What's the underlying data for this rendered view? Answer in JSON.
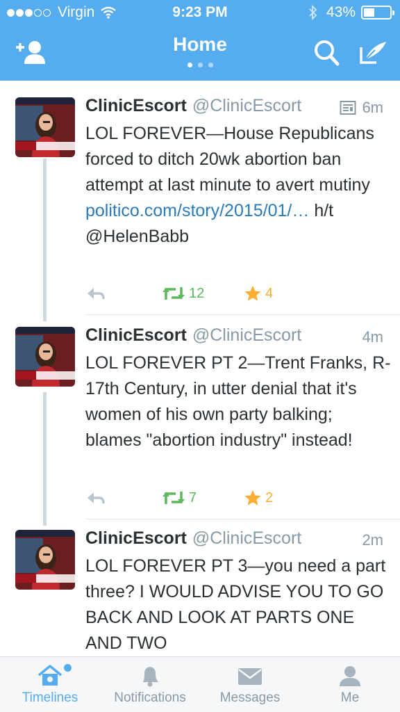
{
  "status_bar": {
    "carrier": "Virgin",
    "time": "9:23 PM",
    "battery": "43%",
    "battery_level": 0.43
  },
  "nav": {
    "title": "Home",
    "page_count": 3,
    "active_page": 1
  },
  "colors": {
    "brand": "#55acee",
    "link": "#2b7bb9",
    "retweet": "#5cb85c",
    "favorite": "#ffac33"
  },
  "tweets": [
    {
      "name": "ClinicEscort",
      "handle": "@ClinicEscort",
      "time": "6m",
      "text": "LOL FOREVER—House Republicans forced to ditch 20wk abortion ban attempt at last minute to avert mutiny",
      "link": "politico.com/story/2015/01/…",
      "text_after": " h/t @HelenBabb",
      "retweets": "12",
      "favorites": "4",
      "has_summary_icon": true
    },
    {
      "name": "ClinicEscort",
      "handle": "@ClinicEscort",
      "time": "4m",
      "text": "LOL FOREVER PT 2—Trent Franks, R-17th Century, in utter denial that it's women of his own party balking; blames \"abortion industry\" instead!",
      "retweets": "7",
      "favorites": "2"
    },
    {
      "name": "ClinicEscort",
      "handle": "@ClinicEscort",
      "time": "2m",
      "text": "LOL FOREVER PT 3—you need a part three? I WOULD ADVISE YOU TO GO BACK AND LOOK AT PARTS ONE AND TWO"
    }
  ],
  "tabs": [
    {
      "label": "Timelines",
      "icon": "home-icon",
      "active": true
    },
    {
      "label": "Notifications",
      "icon": "bell-icon"
    },
    {
      "label": "Messages",
      "icon": "envelope-icon"
    },
    {
      "label": "Me",
      "icon": "person-icon"
    }
  ]
}
